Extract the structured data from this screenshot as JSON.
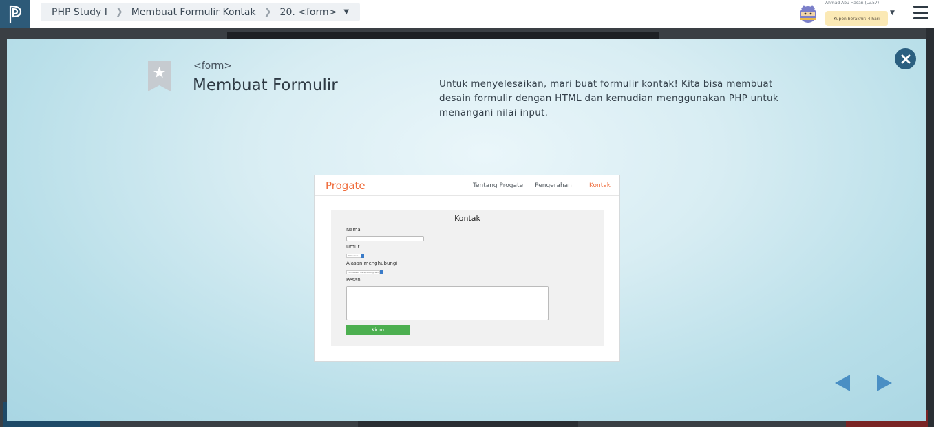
{
  "topbar": {
    "breadcrumb": [
      {
        "label": "PHP Study I"
      },
      {
        "label": "Membuat Formulir Kontak"
      },
      {
        "label": "20. <form>"
      }
    ],
    "user_name": "Ahmad Abu Hasan (Lv.57)",
    "coupon_text": "Kupon berakhir: 4 hari"
  },
  "slide": {
    "tag": "<form>",
    "title": "Membuat Formulir",
    "description": "Untuk menyelesaikan, mari buat formulir kontak! Kita bisa membuat desain formulir dengan HTML dan kemudian menggunakan PHP untuk menangani nilai input."
  },
  "preview": {
    "brand": "Progate",
    "nav": [
      "Tentang Progate",
      "Pengerahan",
      "Kontak"
    ],
    "form_title": "Kontak",
    "labels": {
      "name": "Nama",
      "age": "Umur",
      "reason": "Alasan menghubungi",
      "message": "Pesan"
    },
    "age_select_value": "Pilih umur",
    "reason_select_value": "Pilih alasan menghubungi kami",
    "submit_label": "Kirim"
  },
  "colors": {
    "brand_orange": "#ef6b3a",
    "submit_green": "#4caf50",
    "close_button": "#2b5f80",
    "nav_arrow": "#4a8fc4",
    "coupon_bg": "#fbe9b5"
  },
  "icons": {
    "logo": "progate-logo-icon",
    "avatar": "ninja-cat-avatar-icon",
    "menu": "hamburger-menu-icon",
    "close": "close-circle-icon",
    "bookmark": "bookmark-star-icon",
    "prev": "triangle-left-icon",
    "next": "triangle-right-icon"
  }
}
